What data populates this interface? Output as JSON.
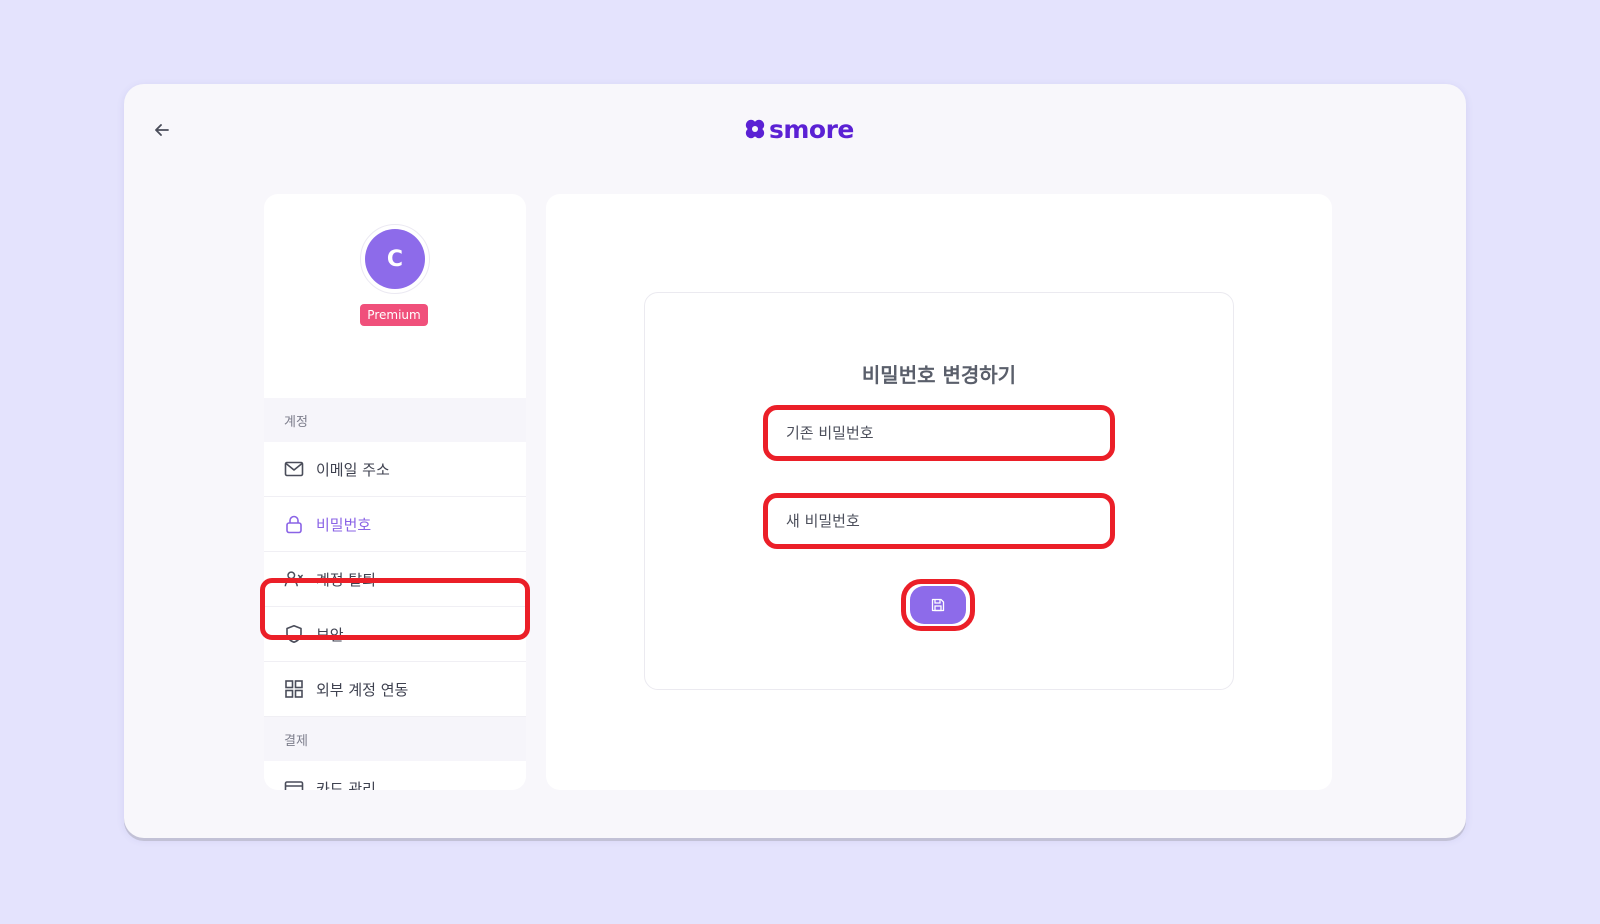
{
  "header": {
    "back_icon": "arrow-left-icon",
    "logo_text": "smore",
    "brand_color": "#5b21d4"
  },
  "profile": {
    "avatar_initial": "C",
    "badge": "Premium",
    "avatar_color": "#8d6bea",
    "badge_color": "#f0507b"
  },
  "sidebar": {
    "sections": [
      {
        "title": "계정",
        "items": [
          {
            "label": "이메일 주소",
            "icon": "mail-icon",
            "active": false
          },
          {
            "label": "비밀번호",
            "icon": "lock-icon",
            "active": true
          },
          {
            "label": "계정 탈퇴",
            "icon": "user-x-icon",
            "active": false
          },
          {
            "label": "보안",
            "icon": "shield-icon",
            "active": false
          },
          {
            "label": "외부 계정 연동",
            "icon": "grid-icon",
            "active": false
          }
        ]
      },
      {
        "title": "결제",
        "items": [
          {
            "label": "카드 관리",
            "icon": "credit-card-icon",
            "active": false
          }
        ]
      }
    ]
  },
  "password_form": {
    "title": "비밀번호 변경하기",
    "current_password_placeholder": "기존 비밀번호",
    "new_password_placeholder": "새 비밀번호",
    "save_icon": "save-icon",
    "accent": "#8d6bea",
    "highlight": "#eb1f28"
  }
}
